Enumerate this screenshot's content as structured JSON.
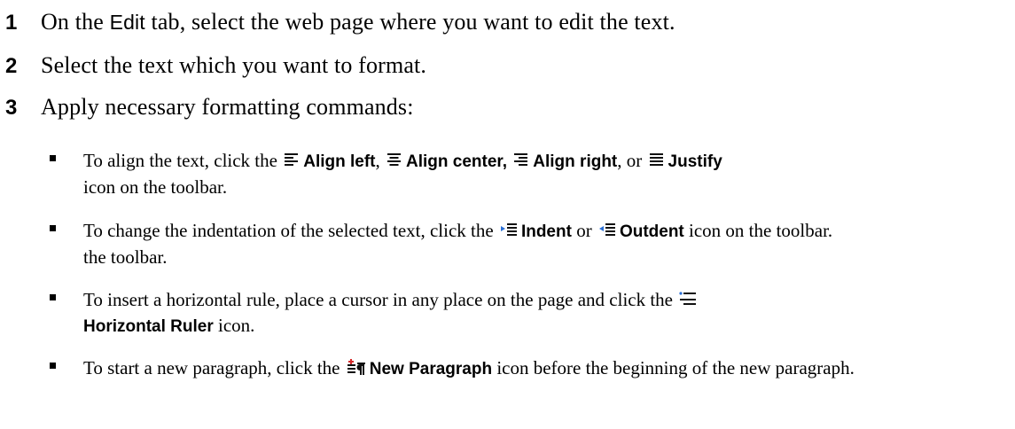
{
  "steps": [
    {
      "number": "1",
      "pre": "On the ",
      "ui": "Edit",
      "post": " tab, select the web page where you want to edit the text."
    },
    {
      "number": "2",
      "text": "Select the text which you want to format."
    },
    {
      "number": "3",
      "text": "Apply necessary formatting commands:"
    }
  ],
  "bullets": {
    "align": {
      "pre": "To align the text, click the ",
      "left": "Align left",
      "sep1": ", ",
      "center": "Align center,",
      "right": "Align right",
      "sep3": ", or ",
      "justify": "Justify",
      "post": "icon on the toolbar.",
      "icons": [
        "align-left-icon",
        "align-center-icon",
        "align-right-icon",
        "justify-icon"
      ]
    },
    "indent": {
      "pre": "To change the indentation of the selected text, click the ",
      "indent": "Indent",
      "mid": " or ",
      "outdent": "Outdent",
      "post": " icon on the toolbar.",
      "icons": [
        "indent-icon",
        "outdent-icon"
      ]
    },
    "rule": {
      "pre": "To insert a horizontal rule, place a cursor in any place on the page and click the ",
      "label": "Horizontal Ruler",
      "post": " icon.",
      "icon": "horizontal-rule-icon"
    },
    "paragraph": {
      "pre": "To start a new paragraph, click the ",
      "label": "New Paragraph",
      "post": " icon before the beginning of the new paragraph.",
      "icon": "new-paragraph-icon"
    }
  }
}
